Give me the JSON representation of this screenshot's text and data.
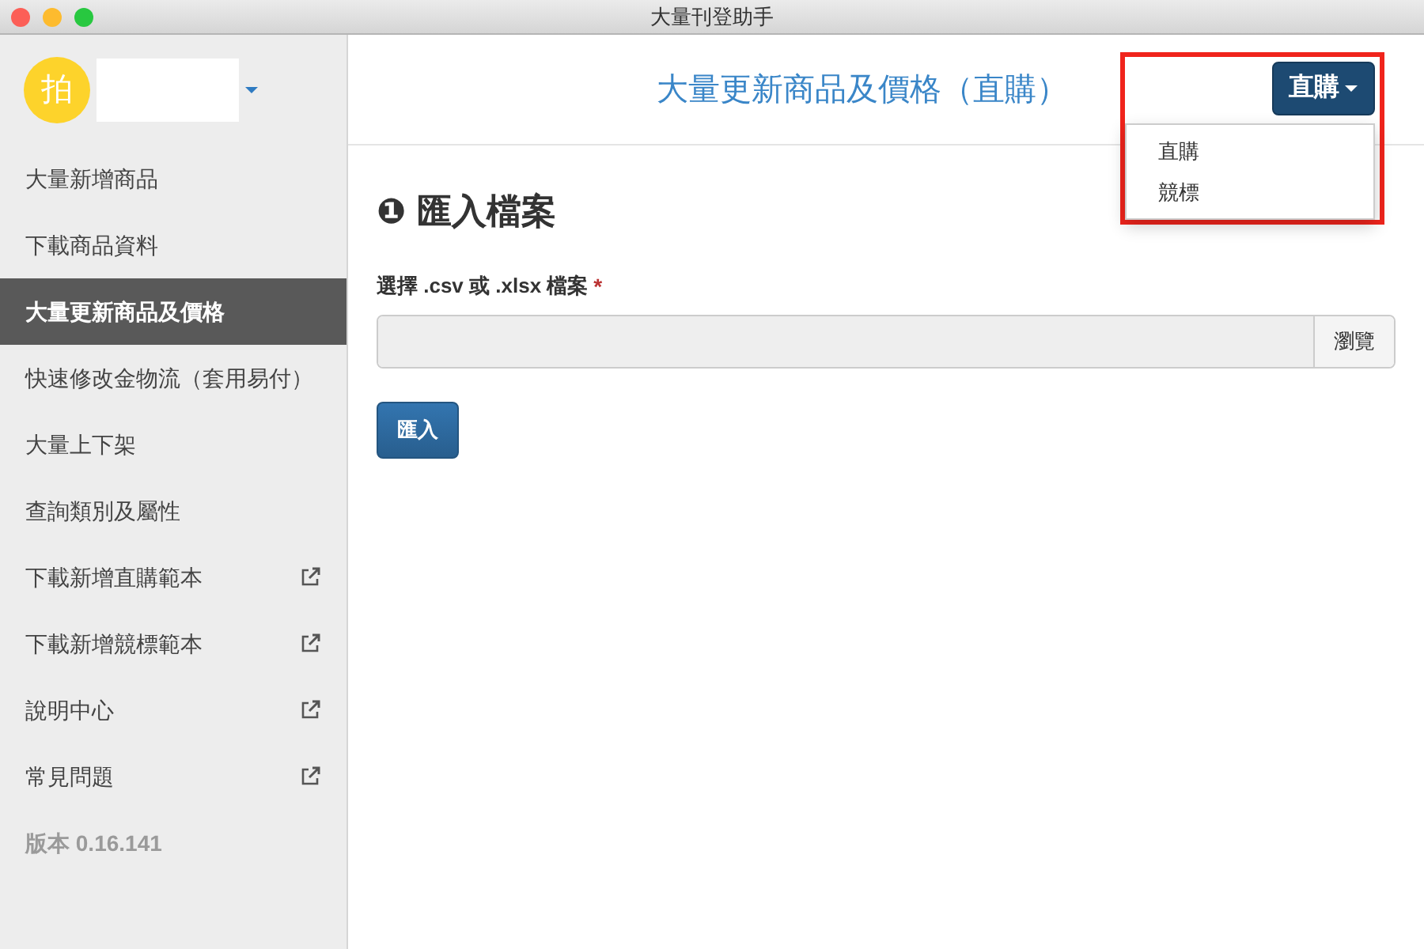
{
  "window": {
    "title": "大量刊登助手"
  },
  "account": {
    "avatar": "拍"
  },
  "sidebar": {
    "items": [
      {
        "label": "大量新增商品",
        "selected": false,
        "external": false
      },
      {
        "label": "下載商品資料",
        "selected": false,
        "external": false
      },
      {
        "label": "大量更新商品及價格",
        "selected": true,
        "external": false
      },
      {
        "label": "快速修改金物流（套用易付）",
        "selected": false,
        "external": false
      },
      {
        "label": "大量上下架",
        "selected": false,
        "external": false
      },
      {
        "label": "查詢類別及屬性",
        "selected": false,
        "external": false
      },
      {
        "label": "下載新增直購範本",
        "selected": false,
        "external": true
      },
      {
        "label": "下載新增競標範本",
        "selected": false,
        "external": true
      },
      {
        "label": "說明中心",
        "selected": false,
        "external": true
      },
      {
        "label": "常見問題",
        "selected": false,
        "external": true
      }
    ],
    "version": "版本 0.16.141"
  },
  "header": {
    "title": "大量更新商品及價格（直購）",
    "dropdown": {
      "label": "直購",
      "expanded": true,
      "options": [
        "直購",
        "競標"
      ]
    }
  },
  "section": {
    "number": "❶",
    "title": "匯入檔案",
    "field_label": "選擇 .csv 或 .xlsx 檔案",
    "required_mark": "*",
    "browse": "瀏覽",
    "submit": "匯入"
  }
}
